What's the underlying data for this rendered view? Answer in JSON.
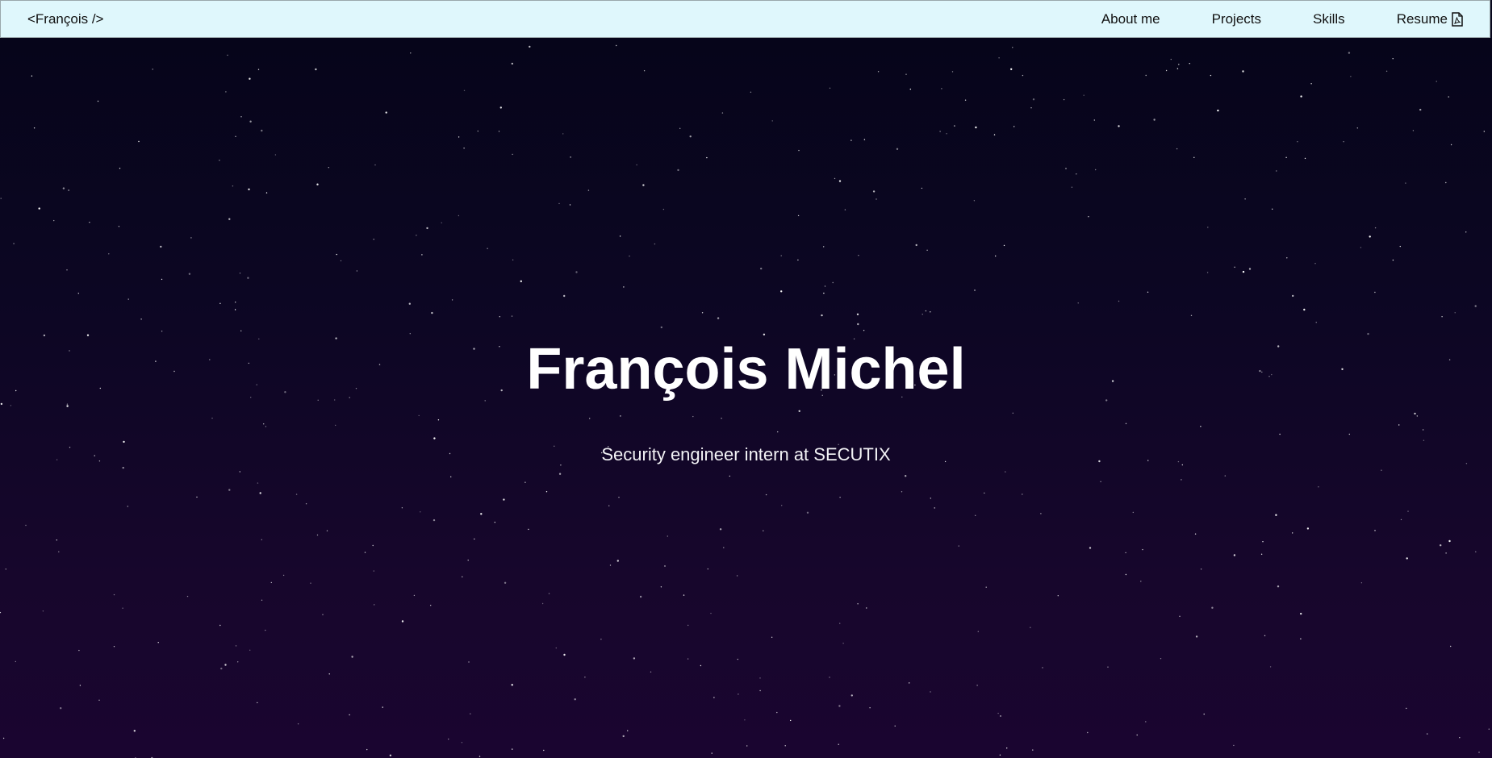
{
  "navbar": {
    "brand": "<François />",
    "links": [
      {
        "label": "About me"
      },
      {
        "label": "Projects"
      },
      {
        "label": "Skills"
      },
      {
        "label": "Resume",
        "icon": "pdf-file-icon"
      }
    ]
  },
  "hero": {
    "title": "François Michel",
    "subtitle": "Security engineer intern at SECUTIX"
  },
  "colors": {
    "navbar_bg": "#dff7fc",
    "hero_top": "#06051a",
    "hero_bottom": "#1a0530",
    "text_light": "#ffffff"
  }
}
